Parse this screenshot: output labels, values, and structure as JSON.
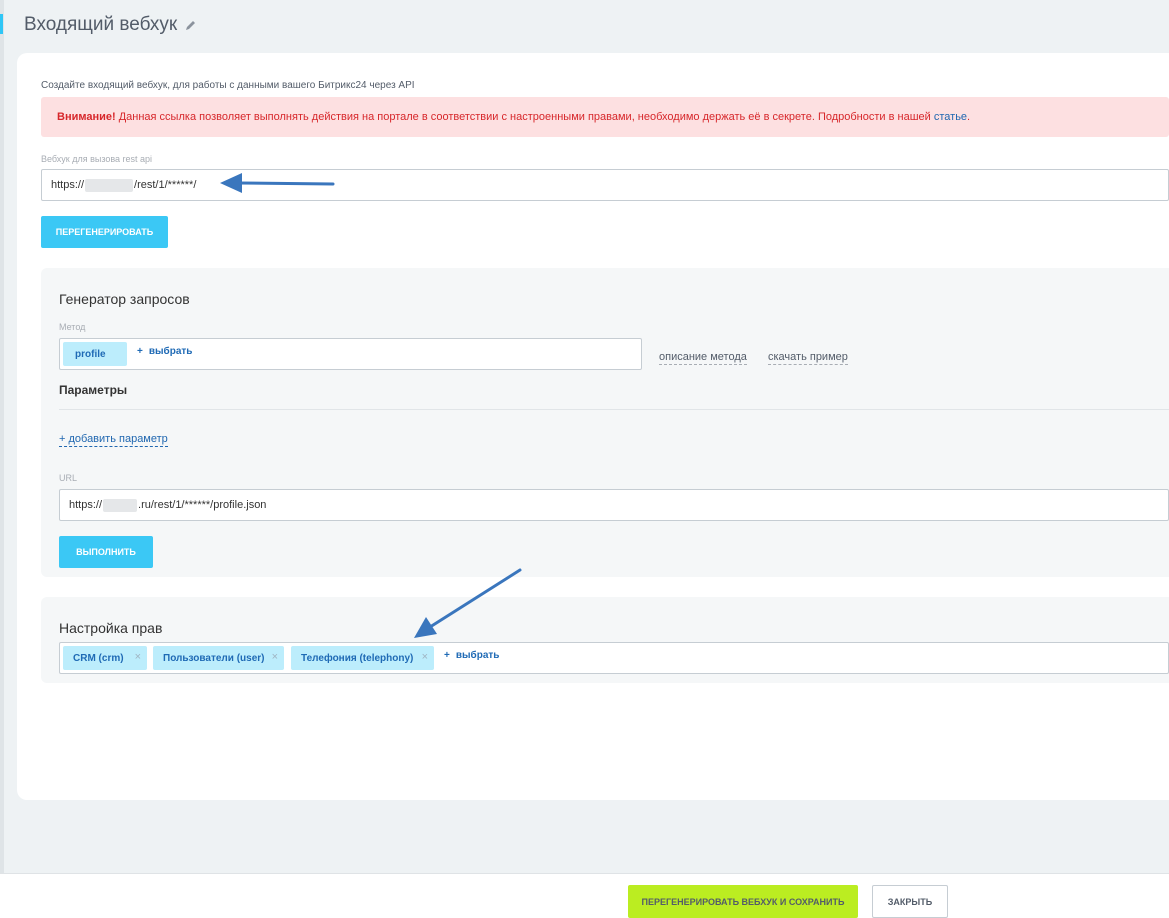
{
  "page": {
    "title": "Входящий вебхук"
  },
  "form": {
    "description": "Создайте входящий вебхук, для работы с данными вашего Битрикс24 через API",
    "alert": {
      "strong": "Внимание!",
      "text": " Данная ссылка позволяет выполнять действия на портале в соответствии с настроенными правами, необходимо держать её в секрете. Подробности в нашей ",
      "link": "статье",
      "end": "."
    },
    "webhook_label": "Вебхук для вызова rest api",
    "webhook_prefix": "https://",
    "webhook_suffix": "/rest/1/******/",
    "regenerate_label": "ПЕРЕГЕНЕРИРОВАТЬ"
  },
  "generator": {
    "title": "Генератор запросов",
    "method_label": "Метод",
    "method_value": "profile",
    "select_label": "выбрать",
    "method_desc_link": "описание метода",
    "download_example_link": "скачать пример",
    "params_title": "Параметры",
    "add_param_label": "добавить параметр",
    "url_label": "URL",
    "url_prefix": "https://",
    "url_suffix": ".ru/rest/1/******/profile.json",
    "execute_label": "ВЫПОЛНИТЬ"
  },
  "permissions": {
    "title": "Настройка прав",
    "scopes": [
      {
        "label": "CRM (crm)"
      },
      {
        "label": "Пользователи (user)"
      },
      {
        "label": "Телефония (telephony)"
      }
    ],
    "remove_glyph": "×",
    "select_label": "выбрать"
  },
  "footer": {
    "save_label": "ПЕРЕГЕНЕРИРОВАТЬ ВЕБХУК И СОХРАНИТЬ",
    "close_label": "ЗАКРЫТЬ"
  },
  "colors": {
    "accent": "#3bc8f5",
    "save": "#bbed21",
    "alert_bg": "#fde0e1",
    "alert_text": "#d7272b",
    "arrow": "#3a76bd"
  }
}
